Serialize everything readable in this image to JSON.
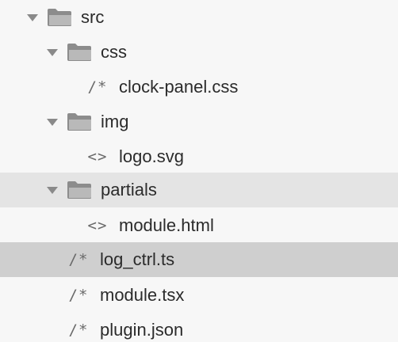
{
  "tree": {
    "items": [
      {
        "name": "src",
        "type": "folder",
        "expanded": true
      },
      {
        "name": "css",
        "type": "folder",
        "expanded": true
      },
      {
        "name": "clock-panel.css",
        "type": "file",
        "icon_text": "/*"
      },
      {
        "name": "img",
        "type": "folder",
        "expanded": true
      },
      {
        "name": "logo.svg",
        "type": "file",
        "icon_text": "<>"
      },
      {
        "name": "partials",
        "type": "folder",
        "expanded": true,
        "state": "hover"
      },
      {
        "name": "module.html",
        "type": "file",
        "icon_text": "<>"
      },
      {
        "name": "log_ctrl.ts",
        "type": "file",
        "icon_text": "/*",
        "state": "selected"
      },
      {
        "name": "module.tsx",
        "type": "file",
        "icon_text": "/*"
      },
      {
        "name": "plugin.json",
        "type": "file",
        "icon_text": "/*"
      }
    ]
  },
  "colors": {
    "background": "#f7f7f7",
    "hover_row": "#e4e4e4",
    "selected_row": "#cfcfcf",
    "folder_icon": "#8c8c8c",
    "text": "#2b2b2b"
  }
}
